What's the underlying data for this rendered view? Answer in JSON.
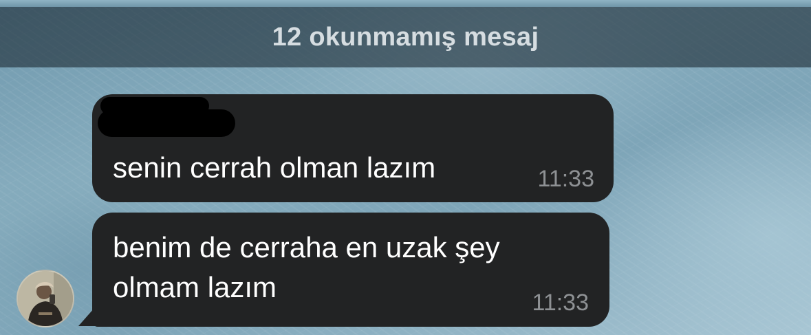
{
  "banner": {
    "unread_label": "12 okunmamış mesaj"
  },
  "messages": [
    {
      "sender_redacted": true,
      "text": "senin cerrah olman lazım",
      "time": "11:33"
    },
    {
      "text": "benim de cerraha en uzak şey olmam lazım",
      "time": "11:33"
    }
  ],
  "icons": {
    "avatar": "user-avatar-photo"
  },
  "colors": {
    "bubble": "#222324",
    "banner": "#1e2d37",
    "time": "#8e9194",
    "text": "#ffffff"
  }
}
